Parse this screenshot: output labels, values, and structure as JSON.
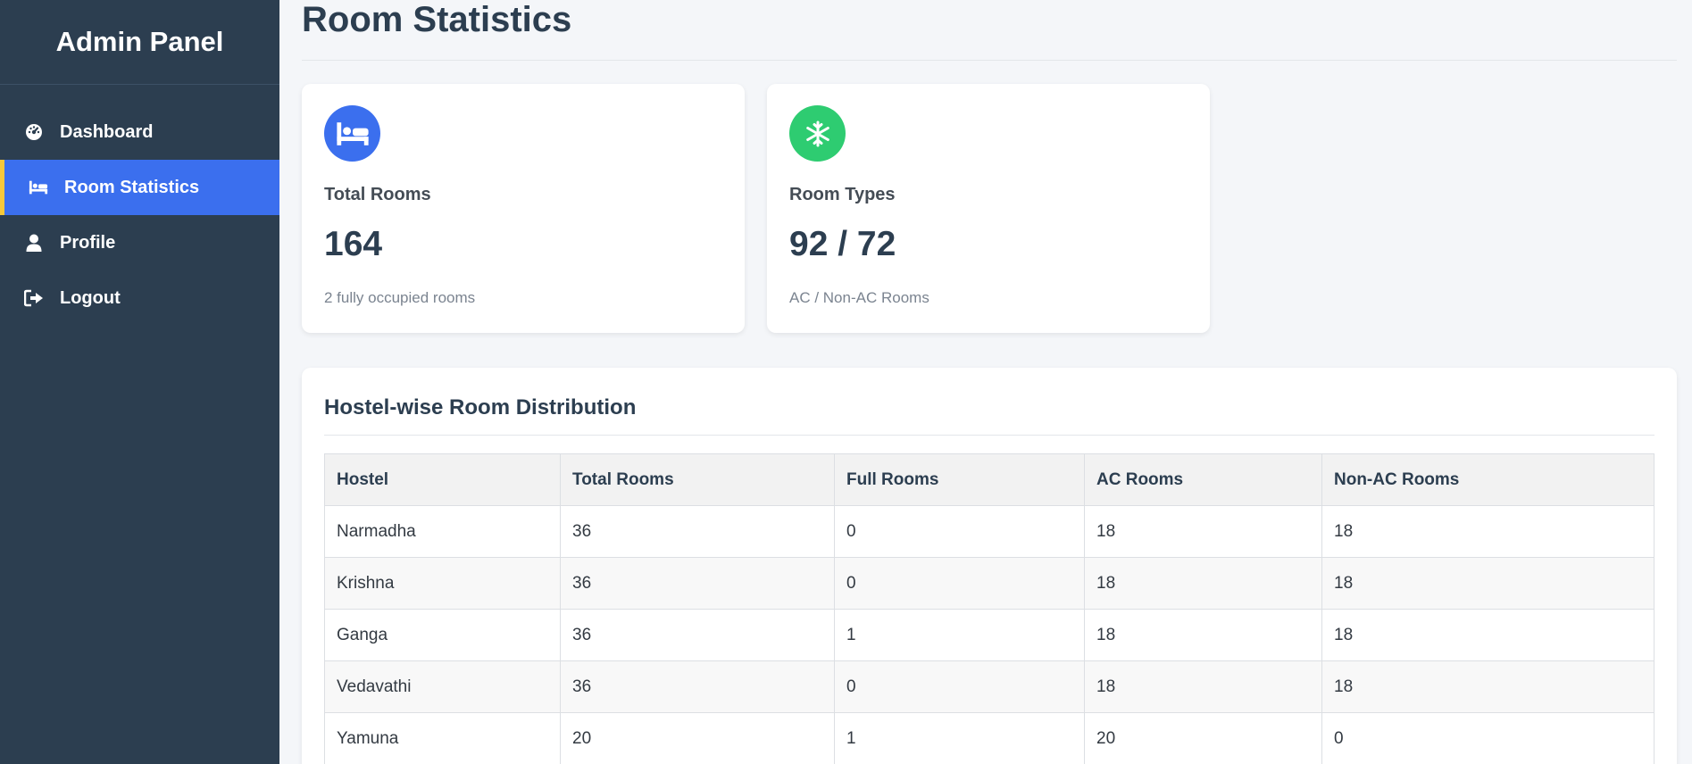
{
  "sidebar": {
    "brand": "Admin Panel",
    "items": [
      {
        "label": "Dashboard",
        "icon": "gauge-icon",
        "active": false
      },
      {
        "label": "Room Statistics",
        "icon": "bed-icon",
        "active": true
      },
      {
        "label": "Profile",
        "icon": "user-icon",
        "active": false
      },
      {
        "label": "Logout",
        "icon": "sign-out-icon",
        "active": false
      }
    ]
  },
  "main": {
    "title": "Room Statistics",
    "cards": [
      {
        "label": "Total Rooms",
        "value": "164",
        "sub": "2 fully occupied rooms",
        "icon": "bed-icon",
        "color": "#3b6fee"
      },
      {
        "label": "Room Types",
        "value": "92 / 72",
        "sub": "AC / Non-AC Rooms",
        "icon": "snowflake-icon",
        "color": "#2ecc71"
      }
    ],
    "table": {
      "title": "Hostel-wise Room Distribution",
      "columns": [
        "Hostel",
        "Total Rooms",
        "Full Rooms",
        "AC Rooms",
        "Non-AC Rooms"
      ],
      "rows": [
        [
          "Narmadha",
          "36",
          "0",
          "18",
          "18"
        ],
        [
          "Krishna",
          "36",
          "0",
          "18",
          "18"
        ],
        [
          "Ganga",
          "36",
          "1",
          "18",
          "18"
        ],
        [
          "Vedavathi",
          "36",
          "0",
          "18",
          "18"
        ],
        [
          "Yamuna",
          "20",
          "1",
          "20",
          "0"
        ]
      ]
    }
  },
  "colors": {
    "sidebar_bg": "#2c3e50",
    "active_bg": "#3b6fee",
    "active_border": "#f6c83a",
    "page_bg": "#f4f6f9"
  }
}
